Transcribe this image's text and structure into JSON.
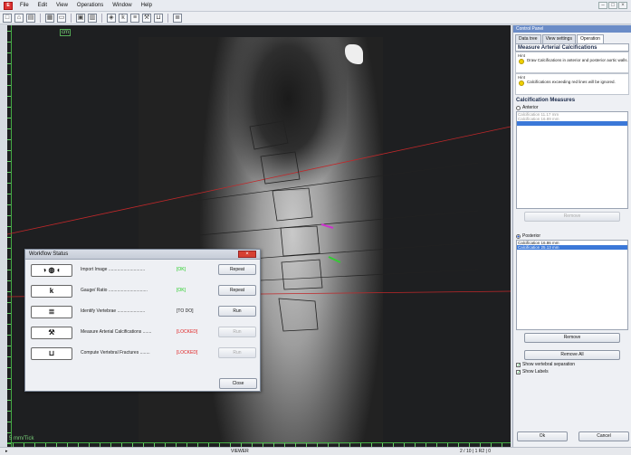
{
  "menubar": {
    "items": [
      "File",
      "Edit",
      "View",
      "Operations",
      "Window",
      "Help"
    ]
  },
  "toolbar": {
    "icons": [
      "new-icon",
      "open-icon",
      "save-icon",
      "grid-icon",
      "window-icon",
      "image-icon",
      "chart-icon",
      "vertebra-icon",
      "k-icon",
      "measure-icon",
      "calcification-icon",
      "box-icon",
      "spine-icon"
    ]
  },
  "viewer": {
    "unit_label": "cm",
    "scale_label": "5 mm/Tick"
  },
  "statusbar": {
    "center": "VIEWER",
    "right": "2 / 10 | 1 R2 | 0"
  },
  "workflow": {
    "title": "Workflow Status",
    "rows": [
      {
        "icon": "◑ ◍ ◐",
        "label": "Import Image .............................",
        "status": "[OK]",
        "status_color": "#22cc22",
        "button": "Repeat",
        "enabled": true
      },
      {
        "icon": "k",
        "label": "Gauge/ Ratio ...............................",
        "status": "[OK]",
        "status_color": "#22cc22",
        "button": "Repeat",
        "enabled": true
      },
      {
        "icon": "≣",
        "label": "Identify Vertebrae ......................",
        "status": "[TO DO]",
        "status_color": "#222222",
        "button": "Run",
        "enabled": true
      },
      {
        "icon": "⚒",
        "label": "Measure Arterial Calcifications .......",
        "status": "[LOCKED]",
        "status_color": "#e02020",
        "button": "Run",
        "enabled": false
      },
      {
        "icon": "⊔",
        "label": "Compute Vertebral Fractures ........",
        "status": "[LOCKED]",
        "status_color": "#e02020",
        "button": "Run",
        "enabled": false
      }
    ],
    "close_label": "Close"
  },
  "panel": {
    "title": "Control Panel",
    "tabs": [
      "Data tree",
      "View settings",
      "Operation"
    ],
    "active_tab": "Operation",
    "section_title": "Measure Arterial Calcifications",
    "hint_label_1": "Hint",
    "hint_1": "Draw Calcifications in anterior and posterior aortic walls.",
    "hint_label_2": "Hint",
    "hint_2": "Calcifications exceeding red lines will be ignored.",
    "calc_title": "Calcification Measures",
    "anterior_label": "Anterior",
    "anterior_items": [
      "Calcification 11.17 mm",
      "Calcification 16.89 mm"
    ],
    "remove_label": "Remove",
    "posterior_label": "Posterior",
    "posterior_items": [
      "Calcification 16.86 mm",
      "Calcification 25.13 mm"
    ],
    "remove2_label": "Remove",
    "remove_all_label": "Remove All",
    "show_separation_label": "Show vertebral separation",
    "show_labels_label": "Show Labels",
    "ok_label": "Ok",
    "cancel_label": "Cancel"
  }
}
